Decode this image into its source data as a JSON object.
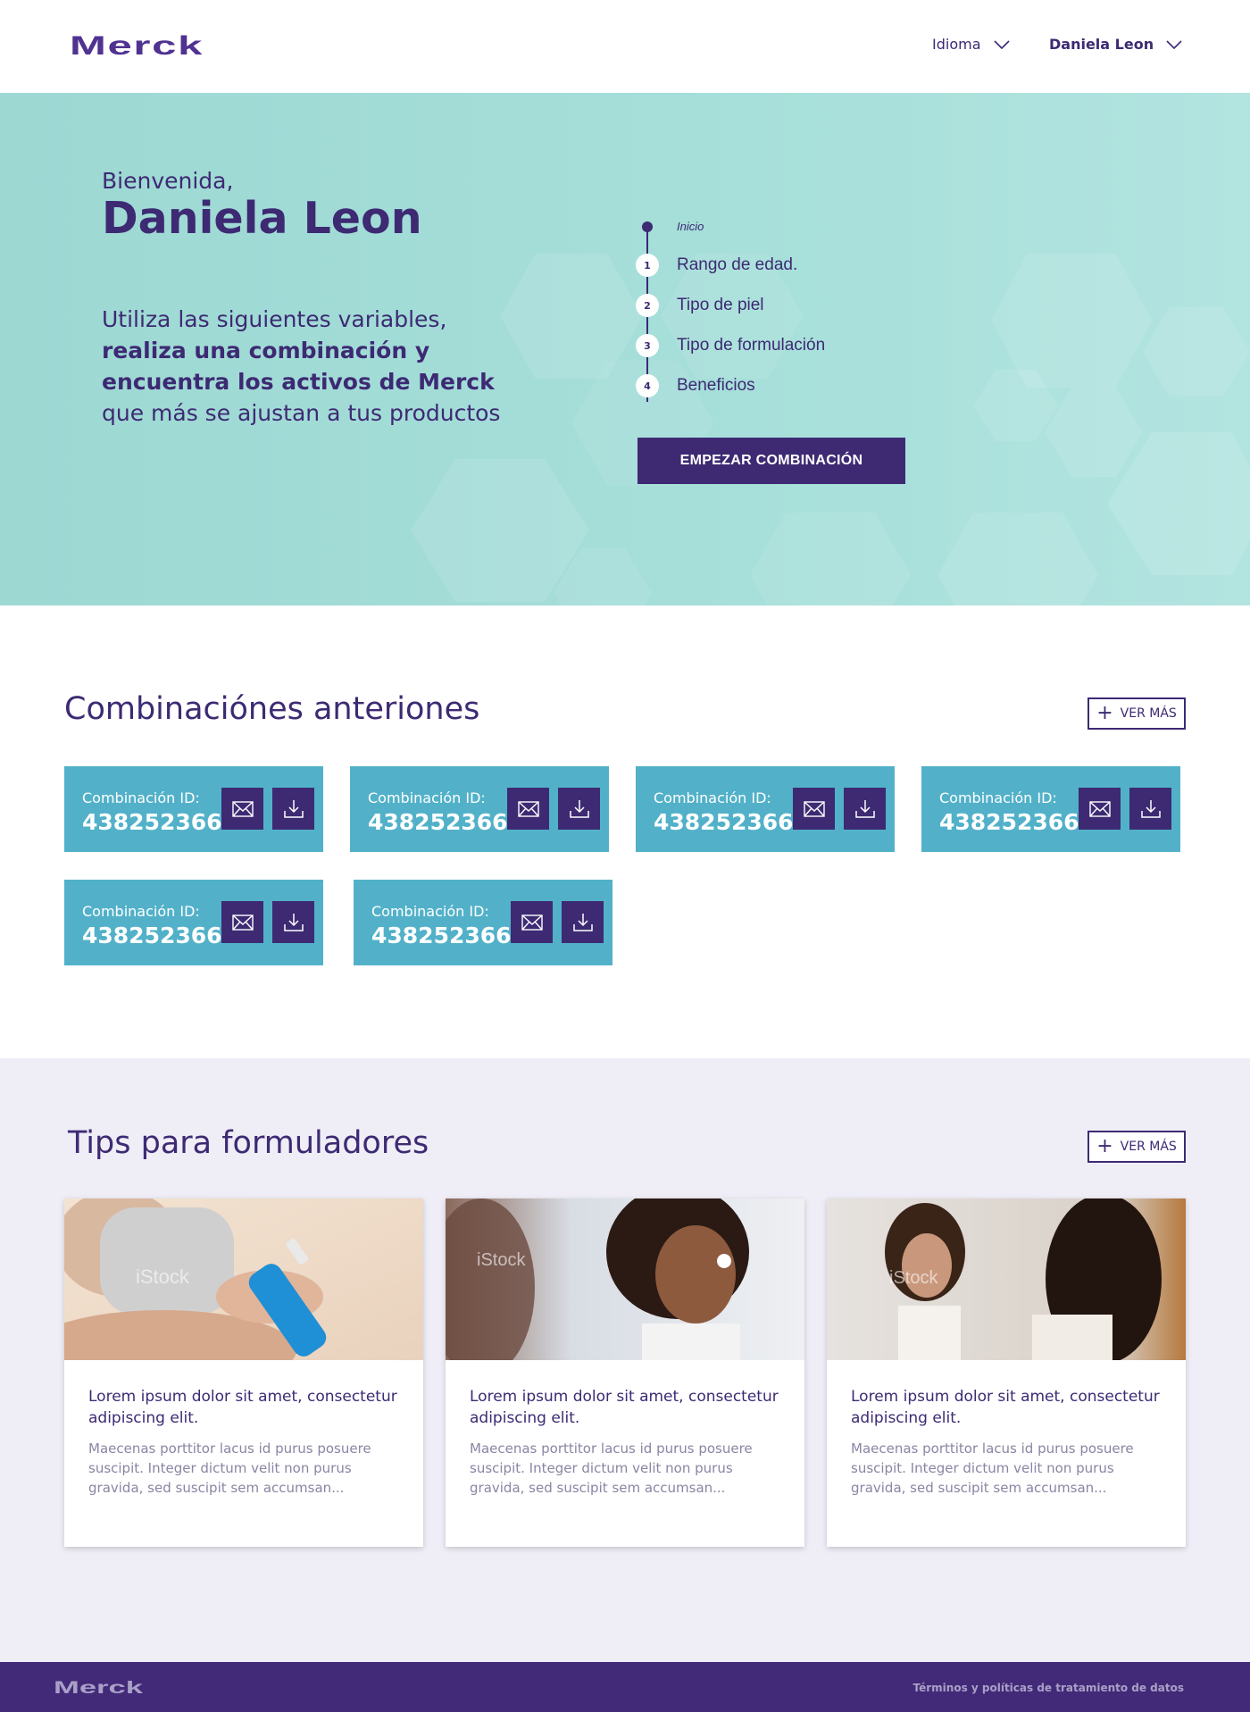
{
  "header": {
    "brand": "Merck",
    "language_label": "Idioma",
    "user_name": "Daniela Leon"
  },
  "hero": {
    "greeting": "Bienvenida,",
    "name": "Daniela Leon",
    "desc_1": "Utiliza las siguientes variables, ",
    "desc_bold": "realiza una combinación y encuentra los activos de Merck",
    "desc_2": " que más se ajustan a tus productos",
    "steps": [
      {
        "num": "",
        "label": "Inicio"
      },
      {
        "num": "1",
        "label": "Rango de edad."
      },
      {
        "num": "2",
        "label": "Tipo de piel"
      },
      {
        "num": "3",
        "label": "Tipo de formulación"
      },
      {
        "num": "4",
        "label": "Beneficios"
      }
    ],
    "cta_label": "EMPEZAR COMBINACIÓN"
  },
  "combinations": {
    "title": "Combinaciónes anteriones",
    "more_label": "VER MÁS",
    "items": [
      {
        "label": "Combinación ID:",
        "id": "438252366"
      },
      {
        "label": "Combinación ID:",
        "id": "438252366"
      },
      {
        "label": "Combinación ID:",
        "id": "438252366"
      },
      {
        "label": "Combinación ID:",
        "id": "438252366"
      },
      {
        "label": "Combinación ID:",
        "id": "438252366"
      },
      {
        "label": "Combinación ID:",
        "id": "438252366"
      }
    ]
  },
  "tips": {
    "title": "Tips para formuladores",
    "more_label": "VER MÁS",
    "items": [
      {
        "title": "Lorem ipsum dolor sit amet, consectetur adipiscing elit.",
        "body": "Maecenas porttitor lacus id purus posuere suscipit. Integer dictum velit non purus gravida, sed suscipit sem accumsan...",
        "watermark": "iStock"
      },
      {
        "title": "Lorem ipsum dolor sit amet, consectetur adipiscing elit.",
        "body": "Maecenas porttitor lacus id purus posuere suscipit. Integer dictum velit non purus gravida, sed suscipit sem accumsan...",
        "watermark": "iStock"
      },
      {
        "title": "Lorem ipsum dolor sit amet, consectetur adipiscing elit.",
        "body": "Maecenas porttitor lacus id purus posuere suscipit. Integer dictum velit non purus gravida, sed suscipit sem accumsan...",
        "watermark": "iStock"
      }
    ]
  },
  "footer": {
    "brand": "Merck",
    "terms_label": "Términos y políticas de tratamiento de datos"
  },
  "colors": {
    "brand_purple": "#3d2a73",
    "hero_teal": "#a7dfda",
    "combo_blue": "#52b1c9",
    "tips_bg": "#efedf6",
    "footer_purple": "#432a78"
  }
}
